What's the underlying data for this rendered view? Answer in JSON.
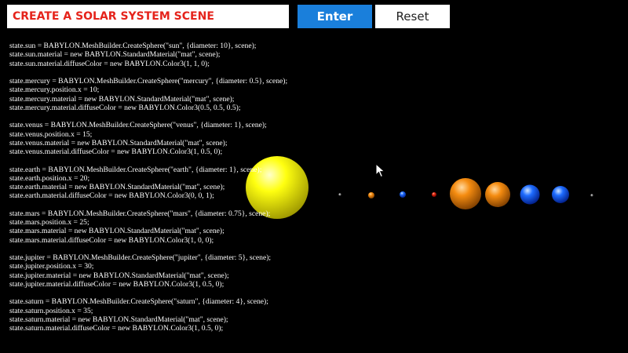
{
  "prompt": {
    "value": "CREATE A SOLAR SYSTEM SCENE",
    "text_color": "#e5231b"
  },
  "buttons": {
    "enter_label": "Enter",
    "enter_color": "#1a7fdb",
    "reset_label": "Reset"
  },
  "code_lines": [
    "state.sun = BABYLON.MeshBuilder.CreateSphere(\"sun\", {diameter: 10}, scene);",
    "state.sun.material = new BABYLON.StandardMaterial(\"mat\", scene);",
    "state.sun.material.diffuseColor = new BABYLON.Color3(1, 1, 0);",
    "",
    "state.mercury = BABYLON.MeshBuilder.CreateSphere(\"mercury\", {diameter: 0.5}, scene);",
    "state.mercury.position.x = 10;",
    "state.mercury.material = new BABYLON.StandardMaterial(\"mat\", scene);",
    "state.mercury.material.diffuseColor = new BABYLON.Color3(0.5, 0.5, 0.5);",
    "",
    "state.venus = BABYLON.MeshBuilder.CreateSphere(\"venus\", {diameter: 1}, scene);",
    "state.venus.position.x = 15;",
    "state.venus.material = new BABYLON.StandardMaterial(\"mat\", scene);",
    "state.venus.material.diffuseColor = new BABYLON.Color3(1, 0.5, 0);",
    "",
    "state.earth = BABYLON.MeshBuilder.CreateSphere(\"earth\", {diameter: 1}, scene);",
    "state.earth.position.x = 20;",
    "state.earth.material = new BABYLON.StandardMaterial(\"mat\", scene);",
    "state.earth.material.diffuseColor = new BABYLON.Color3(0, 0, 1);",
    "",
    "state.mars = BABYLON.MeshBuilder.CreateSphere(\"mars\", {diameter: 0.75}, scene);",
    "state.mars.position.x = 25;",
    "state.mars.material = new BABYLON.StandardMaterial(\"mat\", scene);",
    "state.mars.material.diffuseColor = new BABYLON.Color3(1, 0, 0);",
    "",
    "state.jupiter = BABYLON.MeshBuilder.CreateSphere(\"jupiter\", {diameter: 5}, scene);",
    "state.jupiter.position.x = 30;",
    "state.jupiter.material = new BABYLON.StandardMaterial(\"mat\", scene);",
    "state.jupiter.material.diffuseColor = new BABYLON.Color3(1, 0.5, 0);",
    "",
    "state.saturn = BABYLON.MeshBuilder.CreateSphere(\"saturn\", {diameter: 4}, scene);",
    "state.saturn.position.x = 35;",
    "state.saturn.material = new BABYLON.StandardMaterial(\"mat\", scene);",
    "state.saturn.material.diffuseColor = new BABYLON.Color3(1, 0.5, 0);"
  ],
  "scene": {
    "background": "#000000",
    "colors": {
      "sun": "#ffff00",
      "orange": "#ff8000",
      "blue": "#0050ff",
      "red": "#ff0000",
      "grey": "#808080"
    }
  }
}
